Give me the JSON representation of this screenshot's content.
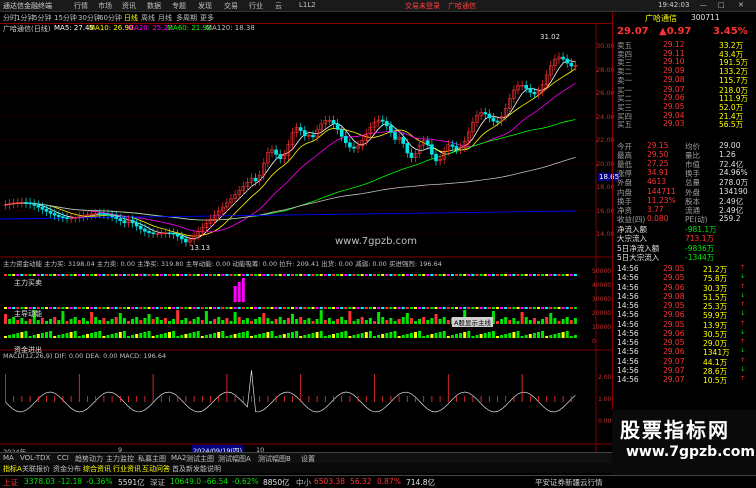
{
  "titlebar": {
    "app": "通达信金融终端",
    "menus": [
      "行情",
      "市场",
      "资讯",
      "数据",
      "专题",
      "发现",
      "交易",
      "行业",
      "云",
      "L1L2"
    ],
    "trade_status": "交易未登录",
    "stock_title": "广哈通信",
    "time": "19:42:03"
  },
  "toolbar": {
    "periods": [
      "分时",
      "1分钟",
      "5分钟",
      "15分钟",
      "30分钟",
      "60分钟",
      "日线",
      "周线",
      "月线",
      "多周期",
      "更多"
    ],
    "active_period": "日线"
  },
  "infoline": {
    "name": "广哈通信(日线)",
    "ma5": "MA5: 27.45",
    "ma10": "MA10: 26.90",
    "ma20": "MA20: 25.22",
    "ma60": "MA60: 21.92",
    "ma120": "MA120: 18.38"
  },
  "main_chart": {
    "y_ticks": [
      "30.00",
      "28.00",
      "26.00",
      "24.00",
      "22.00",
      "20.00",
      "18.00",
      "16.00",
      "14.00"
    ],
    "high_label": "31.02",
    "low_label": "13.13",
    "cursor_price": "18.65",
    "watermark": "www.7gpzb.com"
  },
  "sub1": {
    "label_line": "主力资金动能 主力买: 3198.04  主力卖: 0.00  主净买: 319.80  主导动能: 0.00  动能吸筹: 0.00  拉升: 209.41  出货: 0.00  减弱: 0.00  买进强烈: 196.64",
    "label_buy": "主力买卖",
    "label_kinetic": "主导动能",
    "label_cash": "资金进出",
    "y_ticks": [
      "50000",
      "40000",
      "30000",
      "20000",
      "10000",
      "0"
    ],
    "tooltip": "A股显示主线"
  },
  "macd": {
    "label": "MACD(12,26,9)  DIF: 0.00  DEA: 0.00  MACD: 196.64",
    "y_ticks": [
      "2.00",
      "1.00",
      "0.00"
    ]
  },
  "x_axis": {
    "start": "2024年",
    "mid_label": "9",
    "date_label": "2024/09/19(四)",
    "tick10": "10"
  },
  "bottom_tabs": [
    "指标A",
    "关联报价",
    "资金分布",
    "综合资讯",
    "行业资讯",
    "互动问答",
    "首及新发能说明"
  ],
  "bottom_tabs_top": [
    "MA",
    "VOL-TDX",
    "CCI",
    "趋势动力",
    "主力监控",
    "私募主图",
    "MA2",
    "测试主图",
    "测试幅图A",
    "测试幅图B",
    "设置"
  ],
  "right": {
    "name": "广哈通信",
    "code": "300711",
    "price": "29.07",
    "change": "▲0.97",
    "pct": "3.45%",
    "asks": [
      {
        "label": "卖五",
        "price": "29.12",
        "vol": "33.2万"
      },
      {
        "label": "卖四",
        "price": "29.11",
        "vol": "43.4万"
      },
      {
        "label": "卖三",
        "price": "29.10",
        "vol": "191.5万"
      },
      {
        "label": "卖二",
        "price": "29.09",
        "vol": "133.2万"
      },
      {
        "label": "卖一",
        "price": "29.08",
        "vol": "115.7万"
      }
    ],
    "bids": [
      {
        "label": "买一",
        "price": "29.07",
        "vol": "218.0万"
      },
      {
        "label": "买二",
        "price": "29.06",
        "vol": "111.9万"
      },
      {
        "label": "买三",
        "price": "29.05",
        "vol": "52.0万"
      },
      {
        "label": "买四",
        "price": "29.04",
        "vol": "21.4万"
      },
      {
        "label": "买五",
        "price": "29.03",
        "vol": "56.5万"
      }
    ],
    "stats": [
      {
        "l1": "今开",
        "v1": "29.15",
        "l2": "均价",
        "v2": "29.00"
      },
      {
        "l1": "最高",
        "v1": "29.50",
        "l2": "量比",
        "v2": "1.26"
      },
      {
        "l1": "最低",
        "v1": "27.25",
        "l2": "市值",
        "v2": "72.4亿"
      },
      {
        "l1": "涨停",
        "v1": "34.91",
        "l2": "换手",
        "v2": "24.96%"
      },
      {
        "l1": "外盘",
        "v1": "4613",
        "l2": "总量",
        "v2": "278.0万"
      },
      {
        "l1": "内盘",
        "v1": "144711",
        "l2": "外盘",
        "v2": "134190"
      },
      {
        "l1": "换手",
        "v1": "11.23%",
        "l2": "股本",
        "v2": "2.49亿"
      },
      {
        "l1": "净资",
        "v1": "3.77",
        "l2": "流通",
        "v2": "2.49亿"
      },
      {
        "l1": "收益(四)",
        "v1": "0.080",
        "l2": "PE(动)",
        "v2": "259.2"
      }
    ],
    "flows": [
      {
        "label": "净流入额",
        "val": "-981.1万"
      },
      {
        "label": "大宗流入",
        "val": "713.1万"
      },
      {
        "label": "5日净流入额",
        "val": "-9836万"
      },
      {
        "label": "5日大宗流入",
        "val": "-1344万"
      }
    ],
    "ticks": [
      {
        "t": "14:56",
        "p": "29.05",
        "v": "21.2万"
      },
      {
        "t": "14:56",
        "p": "29.05",
        "v": "75.8万"
      },
      {
        "t": "14:56",
        "p": "29.06",
        "v": "30.3万"
      },
      {
        "t": "14:56",
        "p": "29.08",
        "v": "51.5万"
      },
      {
        "t": "14:56",
        "p": "29.05",
        "v": "25.3万"
      },
      {
        "t": "14:56",
        "p": "29.06",
        "v": "59.9万"
      },
      {
        "t": "14:56",
        "p": "29.05",
        "v": "13.9万"
      },
      {
        "t": "14:56",
        "p": "29.06",
        "v": "30.5万"
      },
      {
        "t": "14:56",
        "p": "29.05",
        "v": "29.0万"
      },
      {
        "t": "14:56",
        "p": "29.06",
        "v": "1341万"
      },
      {
        "t": "14:56",
        "p": "29.07",
        "v": "44.1万"
      },
      {
        "t": "14:56",
        "p": "29.07",
        "v": "28.6万"
      },
      {
        "t": "14:56",
        "p": "29.07",
        "v": "10.5万"
      }
    ]
  },
  "statusbar": {
    "sh_label": "上证",
    "sh_val": "3378.03",
    "sh_chg": "-12.18",
    "sh_pct": "-0.36%",
    "sh_amt": "5591亿",
    "sz_label": "深证",
    "sz_val": "10649.0",
    "sz_chg": "-66.54",
    "sz_pct": "-0.62%",
    "sz_amt": "8850亿",
    "zx_label": "中小",
    "zx_val": "6503.38",
    "zx_chg": "56.32",
    "zx_pct": "0.87%",
    "zx_amt": "714.8亿",
    "broker": "平安证券新疆云行情"
  },
  "watermark_box": {
    "big": "股票指标网",
    "url": "www.7gpzb.com"
  },
  "colors": {
    "up": "#ff3232",
    "down": "#00e600",
    "ma5": "#ffffff",
    "ma10": "#ffff00",
    "ma20": "#ff00ff",
    "ma60": "#00ff00",
    "ma120": "#c0c0c0",
    "ma250": "#0000ff"
  }
}
